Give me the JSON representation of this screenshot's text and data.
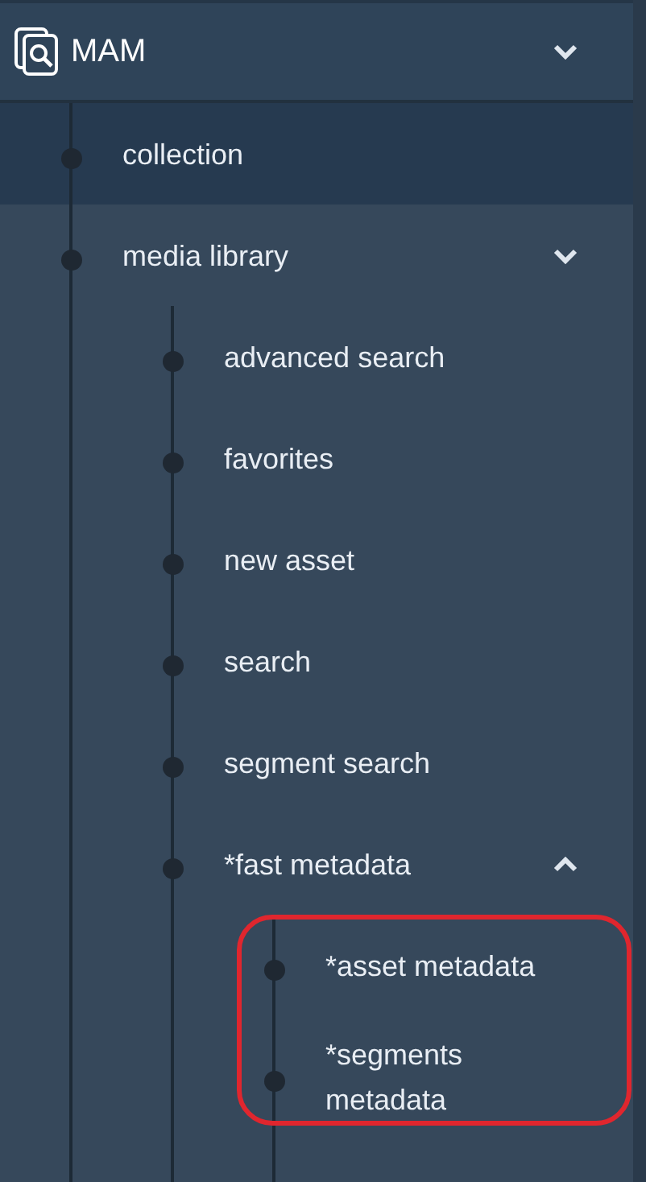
{
  "header": {
    "title": "MAM",
    "expanded": false
  },
  "items": [
    {
      "label": "collection",
      "selected": true
    },
    {
      "label": "media library",
      "selected": false,
      "expanded": false,
      "children": [
        {
          "label": "advanced search",
          "selected": false
        },
        {
          "label": "favorites",
          "selected": false
        },
        {
          "label": "new asset",
          "selected": false
        },
        {
          "label": "search",
          "selected": false
        },
        {
          "label": "segment search",
          "selected": false
        },
        {
          "label": "*fast metadata",
          "selected": false,
          "expanded": true,
          "children_highlighted": true,
          "children": [
            {
              "label": "*asset metadata",
              "selected": false
            },
            {
              "label": "*segments metadata",
              "selected": false
            }
          ]
        }
      ]
    }
  ]
}
